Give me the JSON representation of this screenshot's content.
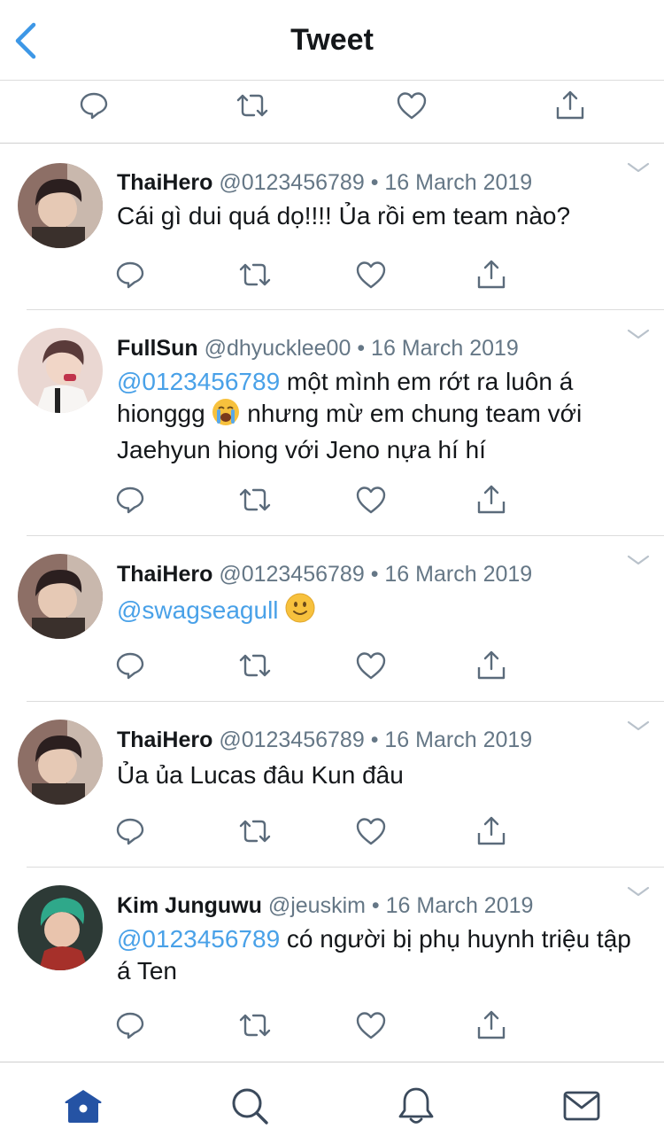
{
  "header": {
    "title": "Tweet",
    "back_icon": "chevron-left-icon",
    "accent_color": "#3d97e6"
  },
  "main_tweet_actions": [
    "reply-icon",
    "retweet-icon",
    "like-icon",
    "share-icon"
  ],
  "replies": [
    {
      "name": "ThaiHero",
      "handle": "@0123456789",
      "date": "16 March 2019",
      "text_parts": [
        {
          "type": "text",
          "value": "Cái gì dui quá dọ!!!! Ủa rồi em team nào?"
        }
      ]
    },
    {
      "name": "FullSun",
      "handle": "@dhyucklee00",
      "date": "16 March 2019",
      "text_parts": [
        {
          "type": "mention",
          "value": "@0123456789"
        },
        {
          "type": "text",
          "value": " một mình em rớt ra luôn á hionggg "
        },
        {
          "type": "emoji",
          "value": "crying-face-emoji"
        },
        {
          "type": "text",
          "value": " nhưng mừ em chung team với Jaehyun hiong với Jeno nựa hí hí"
        }
      ]
    },
    {
      "name": "ThaiHero",
      "handle": "@0123456789",
      "date": "16 March 2019",
      "text_parts": [
        {
          "type": "mention",
          "value": "@swagseagull"
        },
        {
          "type": "text",
          "value": " "
        },
        {
          "type": "emoji",
          "value": "slight-smile-emoji"
        }
      ]
    },
    {
      "name": "ThaiHero",
      "handle": "@0123456789",
      "date": "16 March 2019",
      "text_parts": [
        {
          "type": "text",
          "value": "Ủa ủa Lucas đâu Kun đâu"
        }
      ]
    },
    {
      "name": "Kim Junguwu",
      "handle": "@jeuskim",
      "date": "16 March 2019",
      "text_parts": [
        {
          "type": "mention",
          "value": "@0123456789"
        },
        {
          "type": "text",
          "value": " có người bị phụ huynh triệu tập á Ten"
        }
      ]
    }
  ],
  "separator": "•",
  "tabbar": {
    "items": [
      "home-icon",
      "search-icon",
      "notifications-icon",
      "messages-icon"
    ],
    "active": "home-icon",
    "active_color": "#2553a4",
    "inactive_color": "#3b4a5c"
  }
}
